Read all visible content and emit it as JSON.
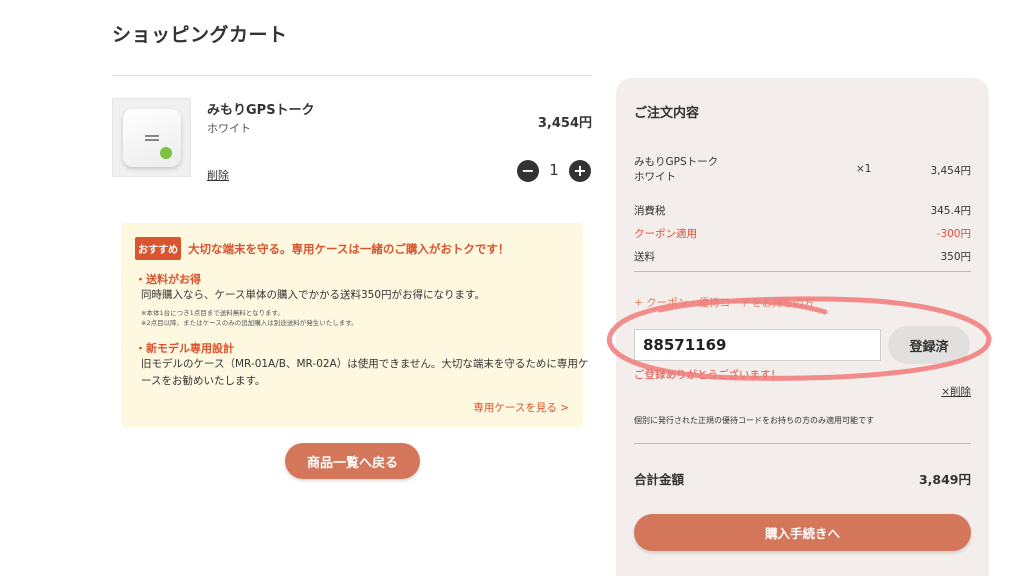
{
  "page": {
    "title": "ショッピングカート"
  },
  "cart_item": {
    "name": "みもりGPSトーク",
    "variant": "ホワイト",
    "price": "3,454円",
    "delete_label": "削除",
    "quantity": "1",
    "minus_icon": "minus-icon",
    "plus_icon": "plus-icon"
  },
  "promo": {
    "badge": "おすすめ",
    "headline": "大切な端末を守る。専用ケースは一緒のご購入がおトクです！",
    "section1_title": "・送料がお得",
    "section1_text": "同時購入なら、ケース単体の購入でかかる送料350円がお得になります。",
    "section1_note1": "※本体1台につき1点目まで送料無料となります。",
    "section1_note2": "※2点目以降、またはケースのみの追加購入は別途送料が発生いたします。",
    "section2_title": "・新モデル専用設計",
    "section2_text_line1": "旧モデルのケース（MR-01A/B、MR-02A）は使用できません。大切な端末を守るために専用ケ",
    "section2_text_line2": "ースをお勧めいたします。",
    "link": "専用ケースを見る >"
  },
  "back_button": "商品一覧へ戻る",
  "summary": {
    "title": "ご注文内容",
    "item_name": "みもりGPSトーク",
    "item_variant": "ホワイト",
    "item_qty": "×1",
    "item_price": "3,454円",
    "tax_label": "消費税",
    "tax_value": "345.4円",
    "coupon_label": "クーポン適用",
    "coupon_value": "-300円",
    "shipping_label": "送料",
    "shipping_value": "350円",
    "coupon_toggle": "+ クーポン・優待コードをお持ちの方",
    "coupon_code": "88571169",
    "coupon_button": "登録済",
    "coupon_thanks": "ご登録ありがとうございます！",
    "coupon_remove": "×削除",
    "coupon_note": "個別に発行された正規の優待コードをお持ちの方のみ適用可能です",
    "total_label": "合計金額",
    "total_value": "3,849円",
    "checkout_button": "購入手続きへ"
  },
  "colors": {
    "accent": "#d4765a",
    "badge": "#d9552e",
    "promo_bg": "#fff8e1",
    "panel_bg": "#f3eeeb",
    "alert": "#e24b3b",
    "highlight": "#f07a7a"
  }
}
